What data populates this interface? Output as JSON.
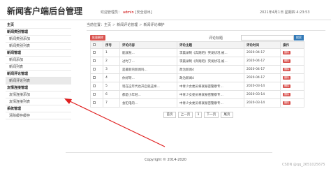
{
  "header": {
    "title": "新闻客户端后台管理",
    "welcome_prefix": "欢迎管理员：",
    "admin_name": "admin",
    "logout_label": "[安全退出]",
    "datetime": "2021年4月1日 星期四 4:23:53"
  },
  "sidebar": {
    "home": "主页",
    "groups": [
      {
        "title": "新闻类别管理",
        "items": [
          "新闻类别添加",
          "新闻类别列表"
        ]
      },
      {
        "title": "新闻管理",
        "items": [
          "新闻添加",
          "新闻列表"
        ]
      },
      {
        "title": "新闻评论管理",
        "items": [
          "新闻评论列表"
        ]
      },
      {
        "title": "友情连接管理",
        "items": [
          "友情连接添加",
          "友情连接列表"
        ]
      },
      {
        "title": "系统管理",
        "items": [
          "清除缓存缓存"
        ]
      }
    ],
    "active_item": "新闻评论列表"
  },
  "breadcrumb": {
    "prefix": "当前位置：",
    "items": [
      "主页",
      "新闻评论管理",
      "新闻评论维护"
    ]
  },
  "toolbar": {
    "delete_selected_label": "批量删除",
    "search_label": "评论标题",
    "search_value": "",
    "search_button_label": "搜索"
  },
  "table": {
    "headers": [
      "",
      "序号",
      "评论内容",
      "评论主题",
      "评论时间",
      "操作"
    ],
    "delete_label": "删除",
    "rows": [
      {
        "no": "1",
        "content": "能就啦...",
        "topic": "李晨录制《奔跑吧》突发状况 被...",
        "time": "2020-04-17"
      },
      {
        "no": "2",
        "content": "过时了...",
        "topic": "李晨录制《奔跑吧》突发状况 被...",
        "time": "2020-04-17"
      },
      {
        "no": "3",
        "content": "是最新的新闻吗...",
        "topic": "政治新闻4",
        "time": "2020-04-17"
      },
      {
        "no": "4",
        "content": "你好呀...",
        "topic": "政治新闻4",
        "time": "2020-04-17"
      },
      {
        "no": "5",
        "content": "现在这年代也开启就这样...",
        "topic": "中青少女委员将就秘密警察专...",
        "time": "2020-03-14"
      },
      {
        "no": "6",
        "content": "都是小年轻...",
        "topic": "中青少女委员将就秘密警察专...",
        "time": "2020-03-14"
      },
      {
        "no": "7",
        "content": "会犯电的...",
        "topic": "中青少女委员将就秘密警察专...",
        "time": "2020-03-14"
      }
    ]
  },
  "pager": {
    "first": "首页",
    "prev": "上一页",
    "current": "1",
    "next": "下一页",
    "last": "尾页"
  },
  "footer": {
    "copyright": "Copyright © 2014-2020"
  },
  "watermark": "CSDN @qq_2651025675",
  "colors": {
    "danger": "#d9534f",
    "primary": "#337ab7",
    "annotation_arrow": "#e02020"
  }
}
